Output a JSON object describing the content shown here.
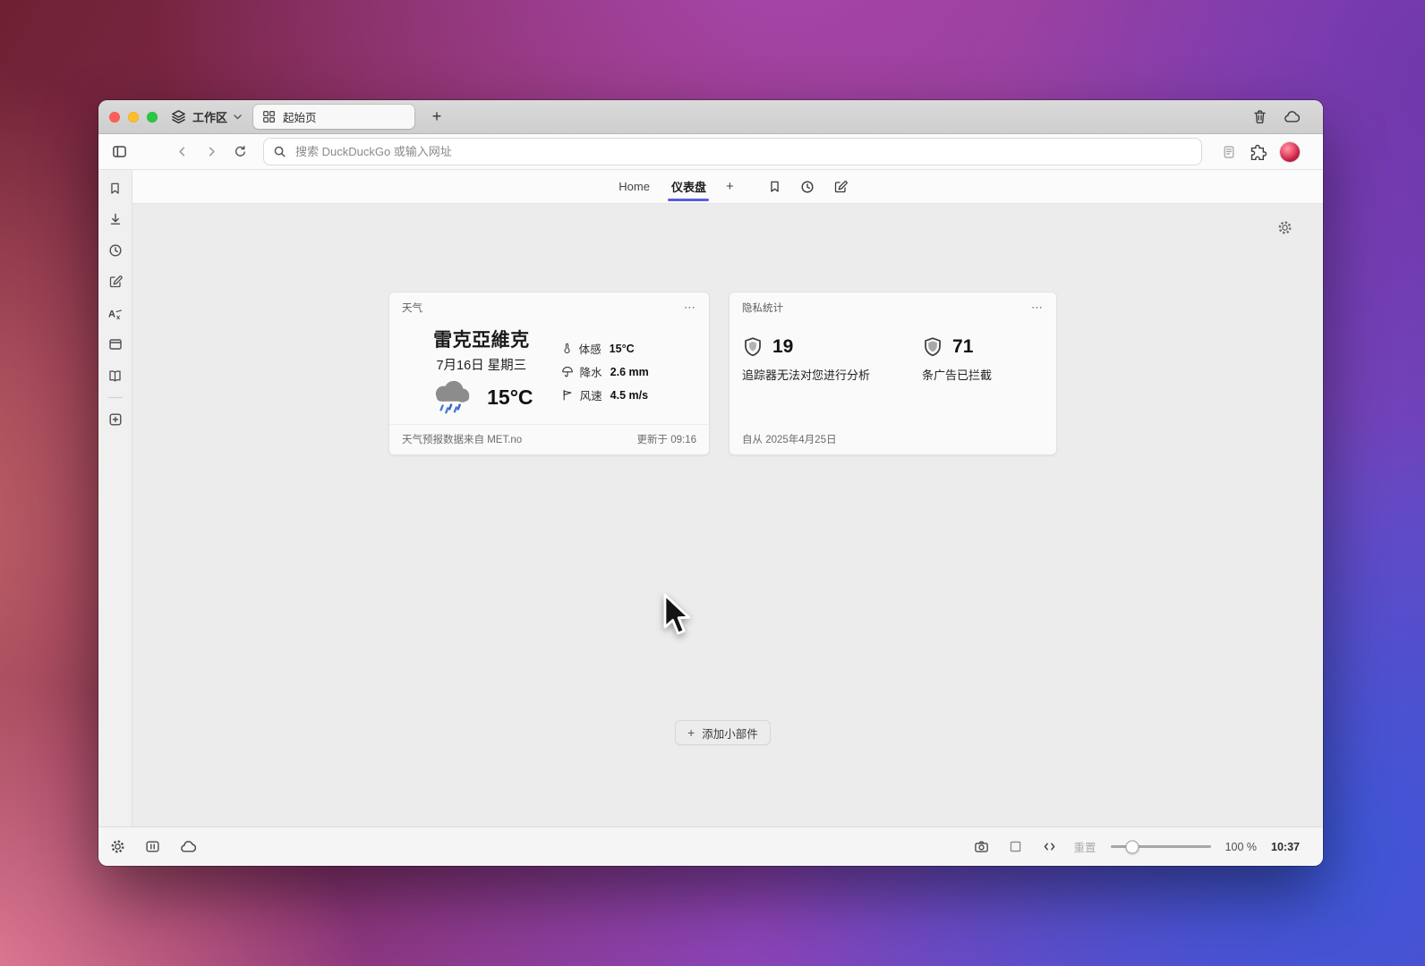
{
  "colors": {
    "accent": "#5b5ce2",
    "traffic_red": "#ff5f57",
    "traffic_yellow": "#febc2e",
    "traffic_green": "#28c840"
  },
  "titlebar": {
    "workspace_label": "工作区",
    "tab_title": "起始页",
    "new_tab": "+"
  },
  "navbar": {
    "search_placeholder": "搜索 DuckDuckGo 或输入网址"
  },
  "pagebar": {
    "tabs": [
      {
        "label": "Home"
      },
      {
        "label": "仪表盘"
      }
    ],
    "add_tab": "+"
  },
  "weather": {
    "title": "天气",
    "menu": "⋯",
    "city": "雷克亞維克",
    "date": "7月16日 星期三",
    "temperature": "15°C",
    "details": [
      {
        "icon": "thermometer-icon",
        "label": "体感",
        "value": "15°C"
      },
      {
        "icon": "umbrella-icon",
        "label": "降水",
        "value": "2.6 mm"
      },
      {
        "icon": "wind-flag-icon",
        "label": "风速",
        "value": "4.5 m/s"
      }
    ],
    "source": "天气预报数据来自 MET.no",
    "updated": "更新于 09:16"
  },
  "privacy": {
    "title": "隐私统计",
    "menu": "⋯",
    "stats": [
      {
        "value": "19",
        "label": "追踪器无法对您进行分析"
      },
      {
        "value": "71",
        "label": "条广告已拦截"
      }
    ],
    "since": "自从 2025年4月25日"
  },
  "add_widget": {
    "plus": "+",
    "label": "添加小部件"
  },
  "statusbar": {
    "reset": "重置",
    "zoom": "100 %",
    "time": "10:37"
  }
}
